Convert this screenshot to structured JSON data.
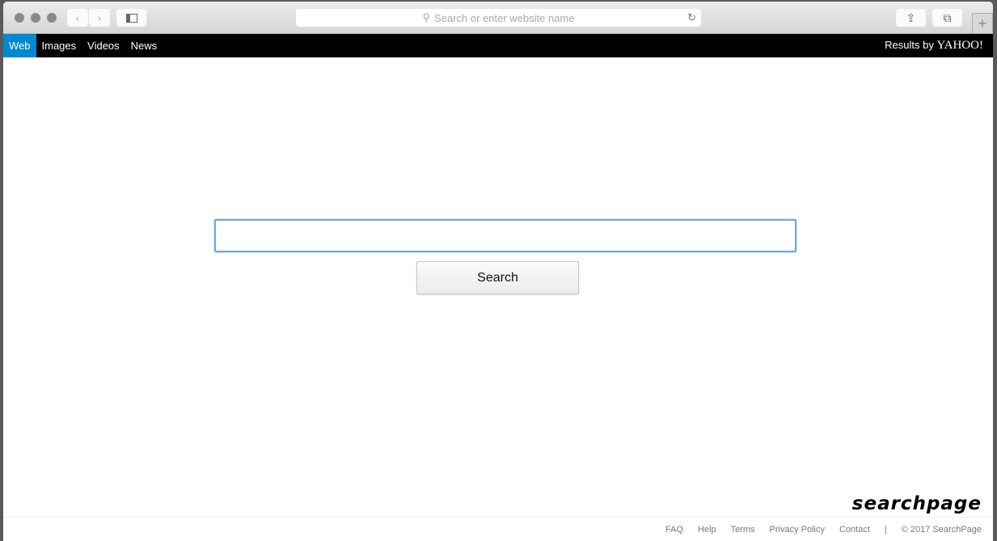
{
  "browser": {
    "address_placeholder": "Search or enter website name",
    "new_tab": "+"
  },
  "nav": {
    "tabs": [
      {
        "label": "Web",
        "active": true
      },
      {
        "label": "Images"
      },
      {
        "label": "Videos"
      },
      {
        "label": "News"
      }
    ],
    "results_by": "Results by",
    "provider": "YAHOO!"
  },
  "search": {
    "value": "",
    "button": "Search"
  },
  "brand": {
    "logo": "searchpage"
  },
  "footer": {
    "links": [
      "FAQ",
      "Help",
      "Terms",
      "Privacy Policy",
      "Contact"
    ],
    "separator": "|",
    "copyright": "© 2017 SearchPage"
  },
  "colors": {
    "active_tab": "#0089d0",
    "nav_bg": "#000000"
  }
}
